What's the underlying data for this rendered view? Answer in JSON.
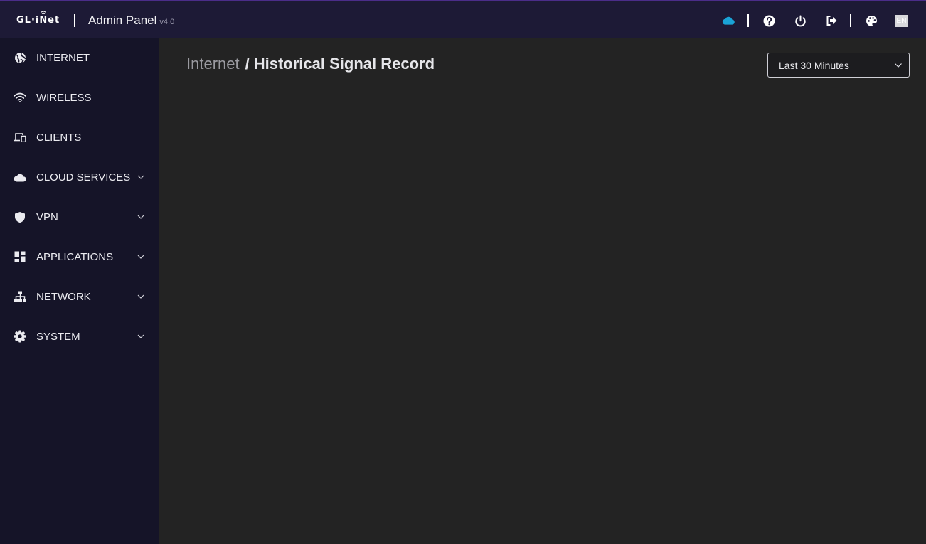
{
  "header": {
    "logo_text": "GL·iNet",
    "title": "Admin Panel",
    "version": "v4.0",
    "icons": [
      "cloud-icon",
      "help-icon",
      "power-icon",
      "logout-icon",
      "palette-icon"
    ],
    "language": "EN",
    "accent_color": "#1aa3d6"
  },
  "sidebar": {
    "items": [
      {
        "label": "INTERNET",
        "icon": "globe-icon",
        "expandable": false
      },
      {
        "label": "WIRELESS",
        "icon": "wifi-icon",
        "expandable": false
      },
      {
        "label": "CLIENTS",
        "icon": "devices-icon",
        "expandable": false
      },
      {
        "label": "CLOUD SERVICES",
        "icon": "cloud-icon",
        "expandable": true
      },
      {
        "label": "VPN",
        "icon": "shield-icon",
        "expandable": true
      },
      {
        "label": "APPLICATIONS",
        "icon": "apps-icon",
        "expandable": true
      },
      {
        "label": "NETWORK",
        "icon": "network-icon",
        "expandable": true
      },
      {
        "label": "SYSTEM",
        "icon": "gear-icon",
        "expandable": true
      }
    ]
  },
  "main": {
    "breadcrumb": {
      "parent": "Internet",
      "separator": "/",
      "current": "Historical Signal Record"
    },
    "time_range": {
      "selected": "Last 30 Minutes"
    }
  }
}
